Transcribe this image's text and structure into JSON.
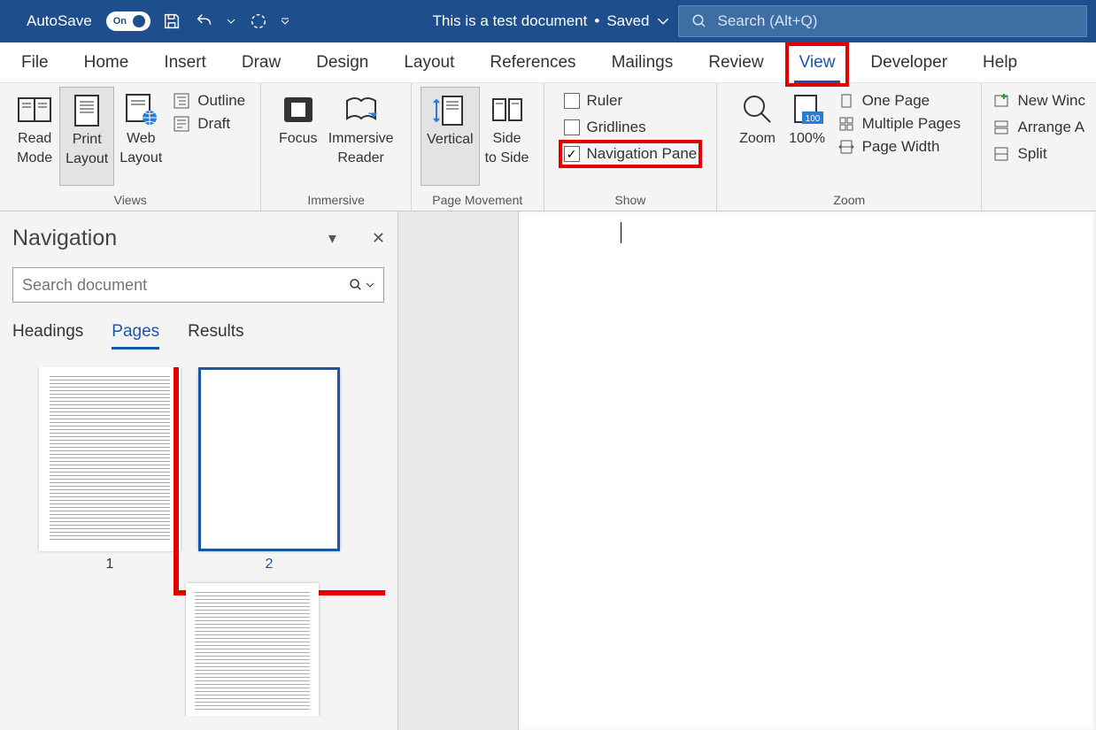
{
  "titlebar": {
    "autosave_label": "AutoSave",
    "autosave_on": "On",
    "doc_title": "This is a test document",
    "save_state": "Saved",
    "search_placeholder": "Search (Alt+Q)"
  },
  "tabs": {
    "file": "File",
    "home": "Home",
    "insert": "Insert",
    "draw": "Draw",
    "design": "Design",
    "layout": "Layout",
    "references": "References",
    "mailings": "Mailings",
    "review": "Review",
    "view": "View",
    "developer": "Developer",
    "help": "Help"
  },
  "ribbon": {
    "views": {
      "read_mode_1": "Read",
      "read_mode_2": "Mode",
      "print_layout_1": "Print",
      "print_layout_2": "Layout",
      "web_layout_1": "Web",
      "web_layout_2": "Layout",
      "outline": "Outline",
      "draft": "Draft",
      "group": "Views"
    },
    "immersive": {
      "focus": "Focus",
      "reader_1": "Immersive",
      "reader_2": "Reader",
      "group": "Immersive"
    },
    "page_movement": {
      "vertical": "Vertical",
      "side_1": "Side",
      "side_2": "to Side",
      "group": "Page Movement"
    },
    "show": {
      "ruler": "Ruler",
      "gridlines": "Gridlines",
      "nav_pane": "Navigation Pane",
      "group": "Show"
    },
    "zoom": {
      "zoom": "Zoom",
      "hundred": "100%",
      "one_page": "One Page",
      "multiple_pages": "Multiple Pages",
      "page_width": "Page Width",
      "group": "Zoom"
    },
    "window": {
      "new_window": "New Winc",
      "arrange": "Arrange A",
      "split": "Split"
    }
  },
  "navpane": {
    "title": "Navigation",
    "search_placeholder": "Search document",
    "tabs": {
      "headings": "Headings",
      "pages": "Pages",
      "results": "Results"
    },
    "page1": "1",
    "page2": "2"
  }
}
